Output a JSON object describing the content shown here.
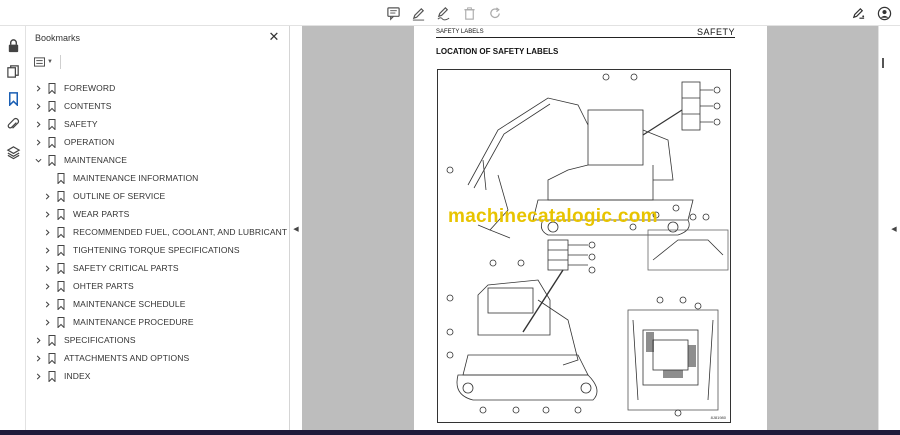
{
  "toolbar": {
    "icons": [
      "comment-icon",
      "pen-icon",
      "signature-icon",
      "trash-icon",
      "redo-icon",
      "pen-edit-icon",
      "account-icon"
    ]
  },
  "rail": {
    "icons": [
      "lock-icon",
      "pages-icon",
      "bookmark-icon",
      "attachment-icon",
      "layers-icon"
    ]
  },
  "bookmarks": {
    "title": "Bookmarks",
    "close_label": "✕",
    "items": [
      {
        "label": "FOREWORD"
      },
      {
        "label": "CONTENTS"
      },
      {
        "label": "SAFETY"
      },
      {
        "label": "OPERATION"
      },
      {
        "label": "MAINTENANCE"
      },
      {
        "label": "MAINTENANCE INFORMATION"
      },
      {
        "label": "OUTLINE OF SERVICE"
      },
      {
        "label": "WEAR PARTS"
      },
      {
        "label": "RECOMMENDED FUEL, COOLANT, AND LUBRICANT"
      },
      {
        "label": "TIGHTENING TORQUE SPECIFICATIONS"
      },
      {
        "label": "SAFETY CRITICAL PARTS"
      },
      {
        "label": "OHTER PARTS"
      },
      {
        "label": "MAINTENANCE SCHEDULE"
      },
      {
        "label": "MAINTENANCE PROCEDURE"
      },
      {
        "label": "SPECIFICATIONS"
      },
      {
        "label": "ATTACHMENTS AND OPTIONS"
      },
      {
        "label": "INDEX"
      }
    ]
  },
  "document": {
    "header_left": "SAFETY LABELS",
    "header_right": "SAFETY",
    "heading": "LOCATION OF SAFETY LABELS",
    "figure_code": "8J81980",
    "watermark": "machinecatalogic.com"
  },
  "colors": {
    "accent": "#1a5fb4",
    "doc_background": "#bdbdbd",
    "watermark": "#e8c400"
  }
}
